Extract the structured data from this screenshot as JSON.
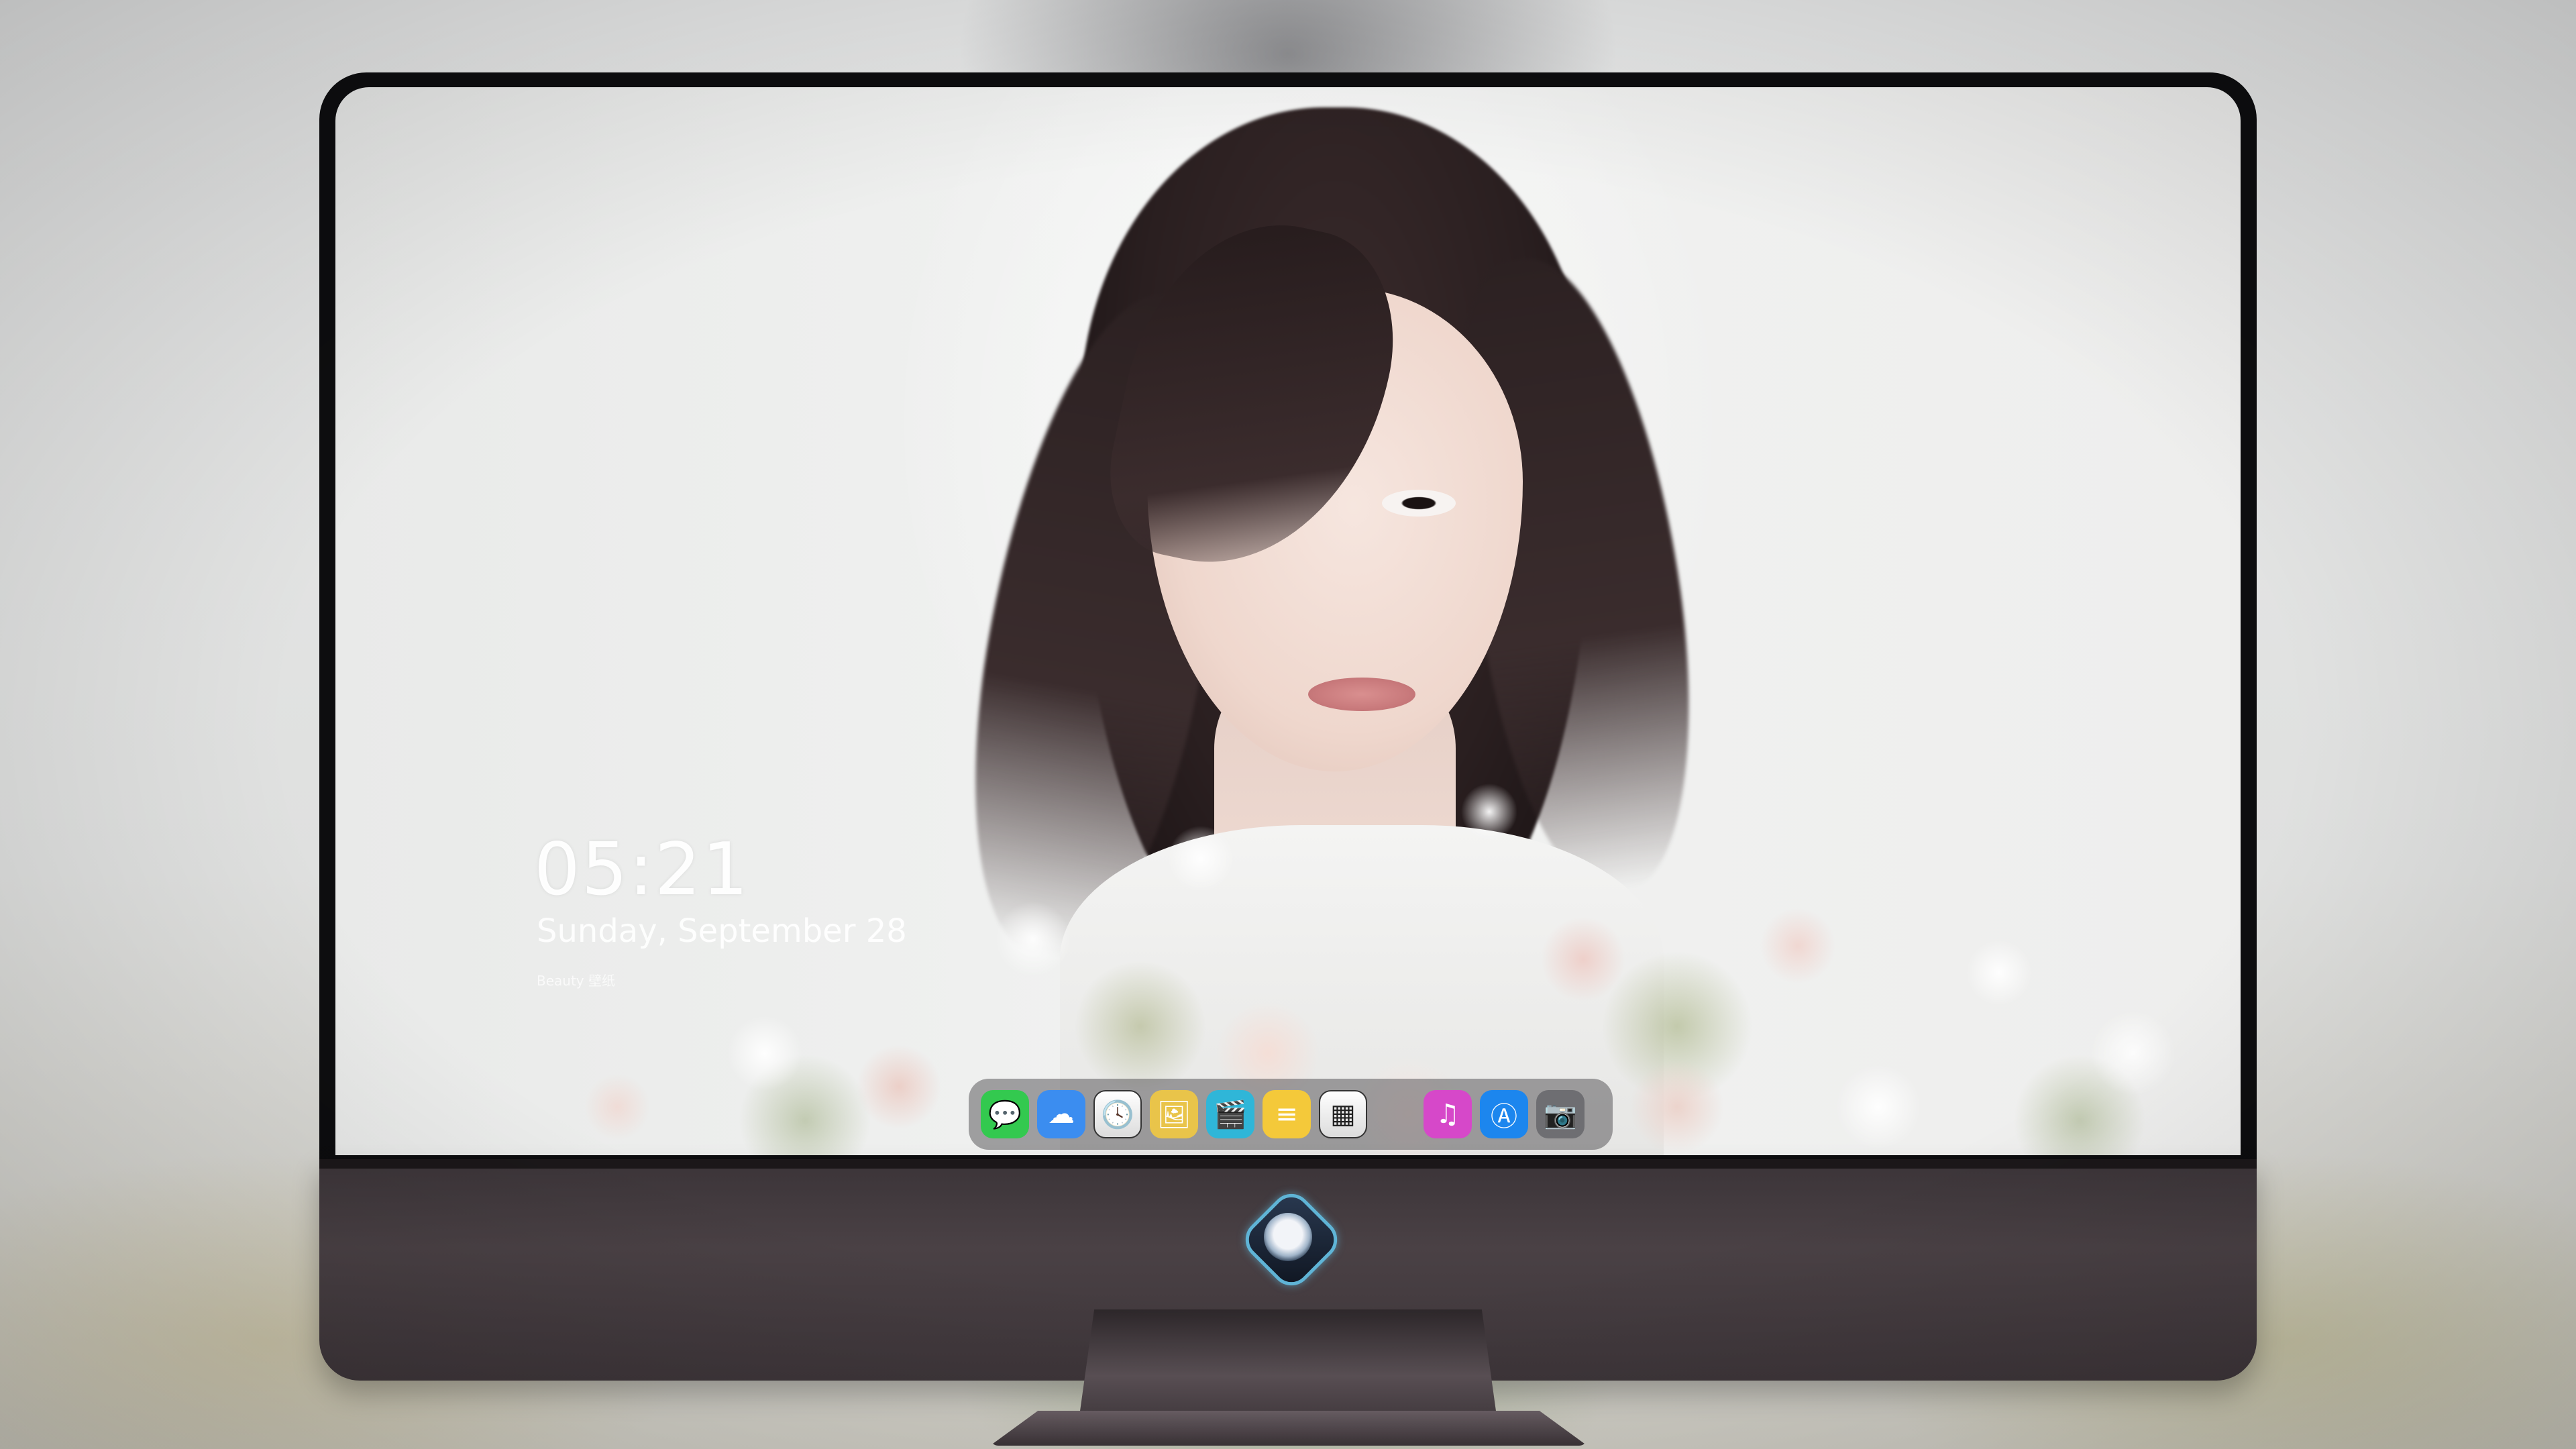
{
  "desktop": {
    "time": "05:21",
    "date": "Sunday, September 28",
    "caption": "Beauty 壁纸"
  },
  "dock": {
    "apps": [
      {
        "name": "messages",
        "icon": "chat-bubble-icon",
        "glyph": "💬",
        "color": "#33c94f"
      },
      {
        "name": "weather",
        "icon": "cloud-icon",
        "glyph": "☁",
        "color": "#3b8df0"
      },
      {
        "name": "clock",
        "icon": "clock-icon",
        "glyph": "🕓",
        "color": "#ffffff"
      },
      {
        "name": "preview",
        "icon": "preview-icon",
        "glyph": "🖼",
        "color": "#e9c44a"
      },
      {
        "name": "videos",
        "icon": "clapperboard-icon",
        "glyph": "🎬",
        "color": "#2fb6d8"
      },
      {
        "name": "notes",
        "icon": "notes-icon",
        "glyph": "≡",
        "color": "#f4c93a"
      },
      {
        "name": "photo-gallery",
        "icon": "gallery-icon",
        "glyph": "▦",
        "color": "#f2f2f2"
      },
      {
        "name": "music",
        "icon": "music-note-icon",
        "glyph": "♫",
        "color": "#d648c9"
      },
      {
        "name": "app-store",
        "icon": "app-store-icon",
        "glyph": "Ⓐ",
        "color": "#1c86ee"
      },
      {
        "name": "camera",
        "icon": "camera-icon",
        "glyph": "📷",
        "color": "#6e6e72"
      }
    ]
  }
}
